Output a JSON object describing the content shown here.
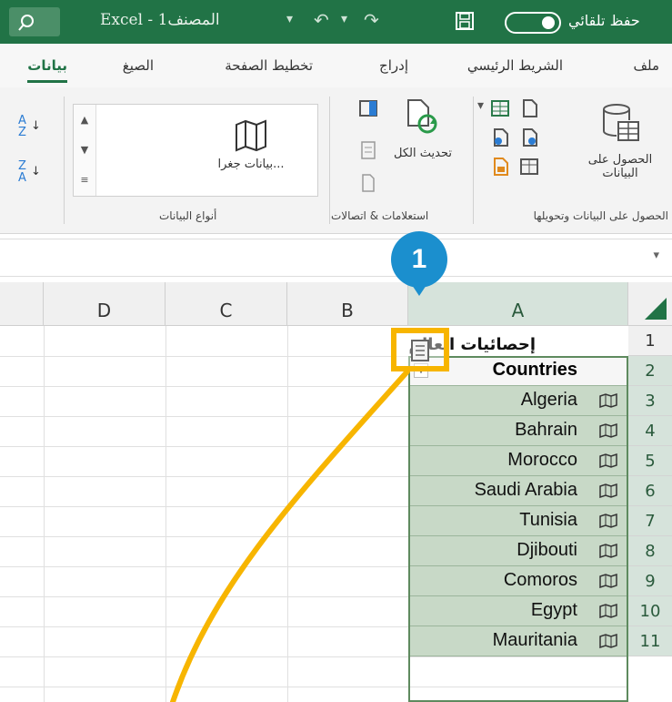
{
  "titlebar": {
    "app_title": "Excel - المصنف1",
    "autosave_label": "حفظ تلقائي",
    "colors": {
      "accent": "#217346"
    }
  },
  "tabs": [
    {
      "label": "ملف"
    },
    {
      "label": "الشريط الرئيسي"
    },
    {
      "label": "إدراج"
    },
    {
      "label": "تخطيط الصفحة"
    },
    {
      "label": "الصيغ"
    },
    {
      "label": "بيانات",
      "active": true
    }
  ],
  "ribbon": {
    "get_data_label": "الحصول على البيانات",
    "get_data_group": "الحصول على البيانات وتحويلها",
    "refresh_label": "تحديث الكل",
    "queries_group": "استعلامات & اتصالات",
    "geography_label": "بيانات جغرا...",
    "data_types_group": "أنواع البيانات"
  },
  "grid": {
    "columns": [
      "A",
      "B",
      "C",
      "D"
    ],
    "rows": [
      "1",
      "2",
      "3",
      "4",
      "5",
      "6",
      "7",
      "8",
      "9",
      "10",
      "11"
    ],
    "title_cell": "إحصائيات العالم",
    "header_cell": "Countries",
    "countries": [
      "Algeria",
      "Bahrain",
      "Morocco",
      "Saudi Arabia",
      "Tunisia",
      "Djibouti",
      "Comoros",
      "Egypt",
      "Mauritania"
    ]
  },
  "callout": {
    "number": "1",
    "color": "#1b8fce",
    "highlight_color": "#f7b500"
  },
  "icons": [
    "search-icon",
    "undo-icon",
    "redo-icon",
    "save-icon",
    "map-icon",
    "sort-asc-icon",
    "sort-desc-icon",
    "refresh-icon",
    "table-icon",
    "database-icon",
    "insert-data-icon"
  ]
}
